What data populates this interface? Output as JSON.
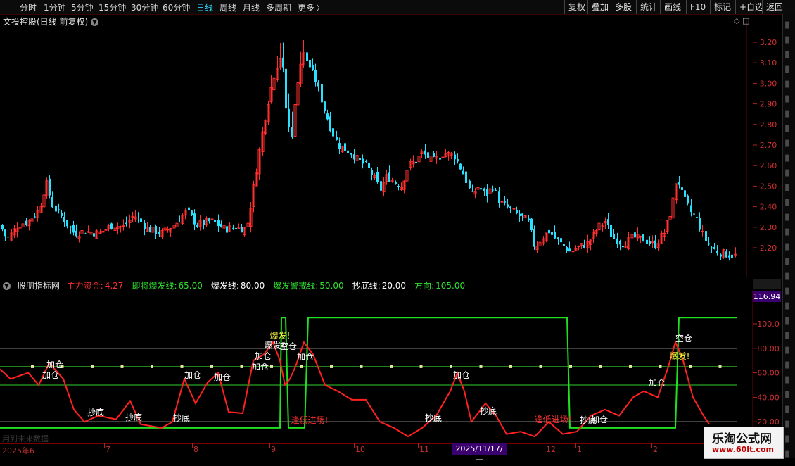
{
  "toolbar": {
    "periods": [
      {
        "label": "分时",
        "active": false
      },
      {
        "label": "1分钟",
        "active": false
      },
      {
        "label": "5分钟",
        "active": false
      },
      {
        "label": "15分钟",
        "active": false
      },
      {
        "label": "30分钟",
        "active": false
      },
      {
        "label": "60分钟",
        "active": false
      },
      {
        "label": "日线",
        "active": true
      },
      {
        "label": "周线",
        "active": false
      },
      {
        "label": "月线",
        "active": false
      },
      {
        "label": "多周期",
        "active": false
      },
      {
        "label": "更多",
        "active": false
      }
    ],
    "more_icon": "chevron-right-icon",
    "right_buttons": [
      "复权",
      "叠加",
      "多股",
      "统计",
      "画线",
      "F10",
      "标记",
      "+自选",
      "返回"
    ]
  },
  "stock": {
    "title": "文投控股(日线 前复权)",
    "title_icon": "chevron-down-icon"
  },
  "price_axis": {
    "ticks": [
      "3.20",
      "3.10",
      "3.00",
      "2.90",
      "2.80",
      "2.70",
      "2.60",
      "2.50",
      "2.40",
      "2.30",
      "2.20"
    ]
  },
  "indicator": {
    "name": "股朋指标网",
    "fields": [
      {
        "label": "主力资金:",
        "value": "4.27",
        "color": "#ff3030"
      },
      {
        "label": "即将爆发线:",
        "value": "65.00",
        "color": "#30e030"
      },
      {
        "label": "爆发线:",
        "value": "80.00",
        "color": "#ffffff"
      },
      {
        "label": "爆发警戒线:",
        "value": "50.00",
        "color": "#30e030"
      },
      {
        "label": "抄底线:",
        "value": "20.00",
        "color": "#ffffff"
      },
      {
        "label": "方向:",
        "value": "105.00",
        "color": "#30e030"
      }
    ],
    "axis_ticks": [
      "100.0",
      "80.00",
      "60.00",
      "40.00",
      "20.00"
    ],
    "current_value": "116.94",
    "annotations": [
      {
        "text": "加仓",
        "color": "#ffffff"
      },
      {
        "text": "加仓",
        "color": "#ffffff"
      },
      {
        "text": "抄底",
        "color": "#ffffff"
      },
      {
        "text": "抄底",
        "color": "#ffffff"
      },
      {
        "text": "抄底",
        "color": "#ffffff"
      },
      {
        "text": "加仓",
        "color": "#ffffff"
      },
      {
        "text": "加仓",
        "color": "#ffffff"
      },
      {
        "text": "加仓",
        "color": "#ffffff"
      },
      {
        "text": "加仓",
        "color": "#ffffff"
      },
      {
        "text": "爆发!",
        "color": "#ffff40"
      },
      {
        "text": "爆发!",
        "color": "#ffffff"
      },
      {
        "text": "空仓",
        "color": "#ffffff"
      },
      {
        "text": "加仓",
        "color": "#ffffff"
      },
      {
        "text": "逢低进场!",
        "color": "#ff3030"
      },
      {
        "text": "抄底",
        "color": "#ffffff"
      },
      {
        "text": "抄底",
        "color": "#ffffff"
      },
      {
        "text": "加仓",
        "color": "#ffffff"
      },
      {
        "text": "抄底",
        "color": "#ffffff"
      },
      {
        "text": "抄底",
        "color": "#ffffff"
      },
      {
        "text": "逢低进场!",
        "color": "#ff3030"
      },
      {
        "text": "抄底",
        "color": "#ffffff"
      },
      {
        "text": "加仓",
        "color": "#ffffff"
      },
      {
        "text": "加仓",
        "color": "#ffffff"
      },
      {
        "text": "爆发!",
        "color": "#ffff40"
      },
      {
        "text": "空仓",
        "color": "#ffffff"
      }
    ]
  },
  "footer": {
    "hint": "用到未来数据",
    "dates": [
      "2025年6",
      "7",
      "8",
      "9",
      "10",
      "11",
      "12",
      "1",
      "2"
    ],
    "highlight_date": "2025/11/17/一"
  },
  "watermark": {
    "line1": "乐淘公式网",
    "line2": "www.60lt.com"
  },
  "colors": {
    "up": "#ff3030",
    "down": "#29e0ff",
    "accent": "#2bd7ff",
    "ind_line": "#ff2020",
    "direction": "#20e020"
  }
}
